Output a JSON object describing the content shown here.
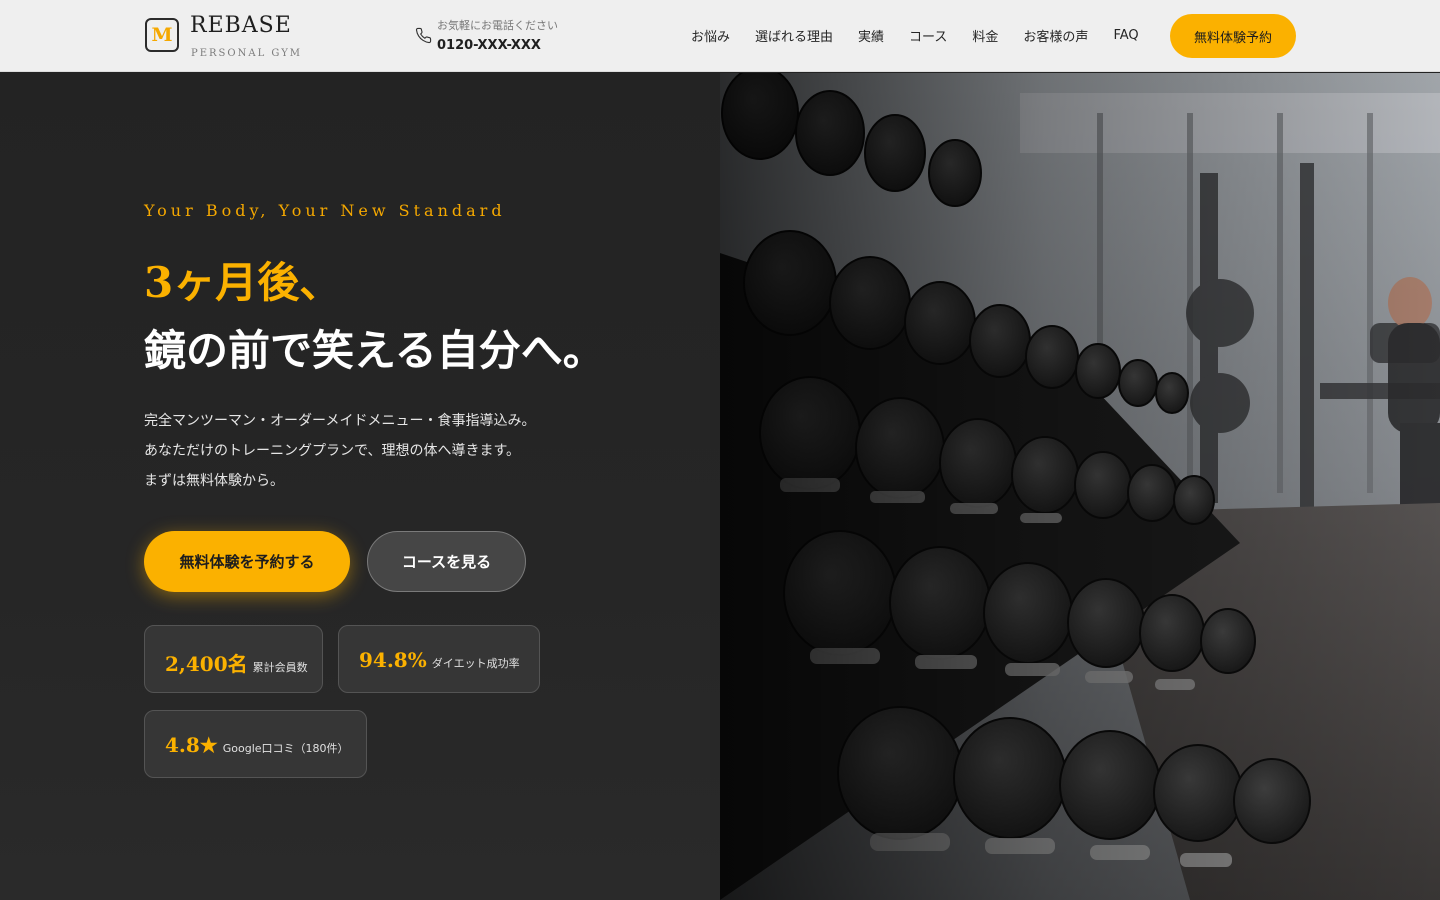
{
  "header": {
    "logo_letter": "M",
    "brand_name": "REBASE",
    "brand_sub": "PERSONAL GYM",
    "phone_note": "お気軽にお電話ください",
    "phone_number": "0120-XXX-XXX",
    "nav": [
      {
        "label": "お悩み"
      },
      {
        "label": "選ばれる理由"
      },
      {
        "label": "実績"
      },
      {
        "label": "コース"
      },
      {
        "label": "料金"
      },
      {
        "label": "お客様の声"
      },
      {
        "label": "FAQ"
      }
    ],
    "cta_label": "無料体験予約"
  },
  "hero": {
    "tagline": "Your Body, Your New Standard",
    "headline_line1": "3ヶ月後、",
    "headline_line2": "鏡の前で笑える自分へ。",
    "lead": [
      "完全マンツーマン・オーダーメイドメニュー・食事指導込み。",
      "あなただけのトレーニングプランで、理想の体へ導きます。",
      "まずは無料体験から。"
    ],
    "primary_button": "無料体験を予約する",
    "secondary_button": "コースを見る",
    "stats": [
      {
        "value": "2,400名",
        "label": "累計会員数"
      },
      {
        "value": "94.8%",
        "label": "ダイエット成功率"
      },
      {
        "value": "4.8★",
        "label": "Google口コミ（180件）"
      }
    ]
  },
  "colors": {
    "accent": "#fbb100",
    "dark_bg": "#232323",
    "header_bg": "#efefef"
  },
  "icons": {
    "logo": "logo-mark-icon",
    "phone": "phone-icon",
    "photo": "dumbbell-rack-photo"
  }
}
